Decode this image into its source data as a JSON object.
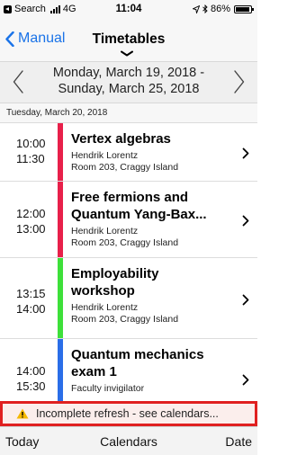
{
  "status_bar": {
    "back_app": "Search",
    "network": "4G",
    "time": "11:04",
    "battery": "86%"
  },
  "nav": {
    "back_label": "Manual",
    "title": "Timetables"
  },
  "week": {
    "line1": "Monday, March 19, 2018 -",
    "line2": "Sunday, March 25, 2018"
  },
  "section": {
    "date": "Tuesday, March 20, 2018"
  },
  "events": [
    {
      "start": "10:00",
      "end": "11:30",
      "title_lines": [
        "Vertex algebras"
      ],
      "person": "Hendrik Lorentz",
      "location": "Room 203, Craggy Island",
      "color": "#e8204a"
    },
    {
      "start": "12:00",
      "end": "13:00",
      "title_lines": [
        "Free fermions and",
        "Quantum Yang-Bax..."
      ],
      "person": "Hendrik Lorentz",
      "location": "Room 203, Craggy Island",
      "color": "#e8204a"
    },
    {
      "start": "13:15",
      "end": "14:00",
      "title_lines": [
        "Employability",
        "workshop"
      ],
      "person": "Hendrik Lorentz",
      "location": "Room 203, Craggy Island",
      "color": "#3ee03a"
    },
    {
      "start": "14:00",
      "end": "15:30",
      "title_lines": [
        "Quantum mechanics",
        "exam 1"
      ],
      "person": "Faculty invigilator",
      "location": "",
      "color": "#2a6ee8"
    }
  ],
  "warning": {
    "text": "Incomplete refresh - see calendars...",
    "icon": "warning-icon"
  },
  "toolbar": {
    "today": "Today",
    "calendars": "Calendars",
    "date": "Date"
  },
  "colors": {
    "accent": "#1a73e8",
    "warning_border": "#e02020"
  }
}
